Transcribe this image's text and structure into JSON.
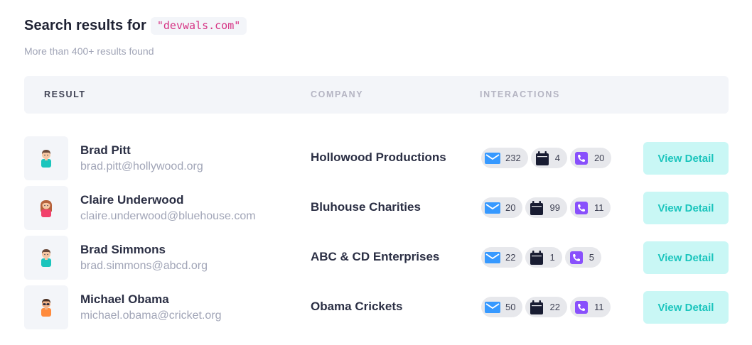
{
  "header": {
    "title": "Search results for",
    "query": "\"devwals.com\"",
    "subtitle": "More than 400+ results found"
  },
  "table": {
    "columns": [
      "RESULT",
      "COMPANY",
      "INTERACTIONS"
    ],
    "rows": [
      {
        "name": "Brad Pitt",
        "email": "brad.pitt@hollywood.org",
        "company": "Hollowood Productions",
        "avatar": "male-avatar-icon",
        "emails": "232",
        "events": "4",
        "calls": "20",
        "action": "View Detail"
      },
      {
        "name": "Claire Underwood",
        "email": "claire.underwood@bluehouse.com",
        "company": "Bluhouse Charities",
        "avatar": "female-avatar-icon",
        "emails": "20",
        "events": "99",
        "calls": "11",
        "action": "View Detail"
      },
      {
        "name": "Brad Simmons",
        "email": "brad.simmons@abcd.org",
        "company": "ABC & CD Enterprises",
        "avatar": "male-avatar-icon",
        "emails": "22",
        "events": "1",
        "calls": "5",
        "action": "View Detail"
      },
      {
        "name": "Michael Obama",
        "email": "michael.obama@cricket.org",
        "company": "Obama Crickets",
        "avatar": "male-glasses-avatar-icon",
        "emails": "50",
        "events": "22",
        "calls": "11",
        "action": "View Detail"
      }
    ]
  },
  "icons": {
    "email": "envelope-icon",
    "events": "calendar-icon",
    "calls": "phone-icon"
  },
  "colors": {
    "email_icon": "#3699ff",
    "calendar_icon": "#181c32",
    "phone_icon": "#8950fc",
    "button_bg": "#c9f7f5",
    "button_text": "#1bc5bd",
    "query_text": "#d63384"
  }
}
